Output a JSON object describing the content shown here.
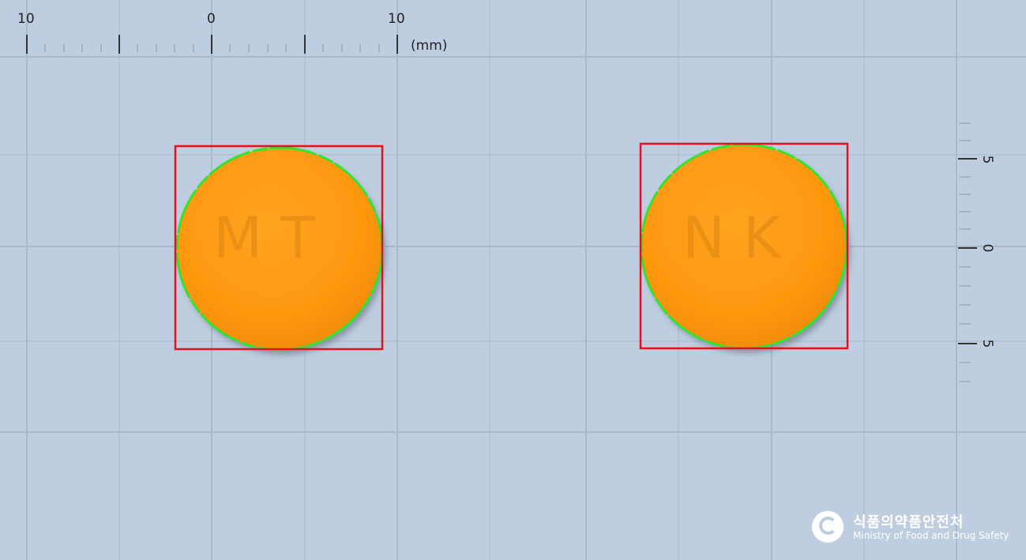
{
  "ruler_top": {
    "labels": [
      "10",
      "0",
      "10"
    ],
    "unit": "(mm)"
  },
  "ruler_right": {
    "labels": [
      "5",
      "0",
      "5"
    ]
  },
  "pills": [
    {
      "imprint": "M T",
      "color": "#ff9a12"
    },
    {
      "imprint": "N K",
      "color": "#ff9a12"
    }
  ],
  "logo": {
    "korean": "식품의약품안전처",
    "english": "Ministry of Food and Drug Safety"
  },
  "colors": {
    "background": "#bfcde0",
    "grid": "#a8b8cc",
    "bbox": "#e0141e",
    "outline": "#2ee62e",
    "pill": "#ff9a12"
  }
}
